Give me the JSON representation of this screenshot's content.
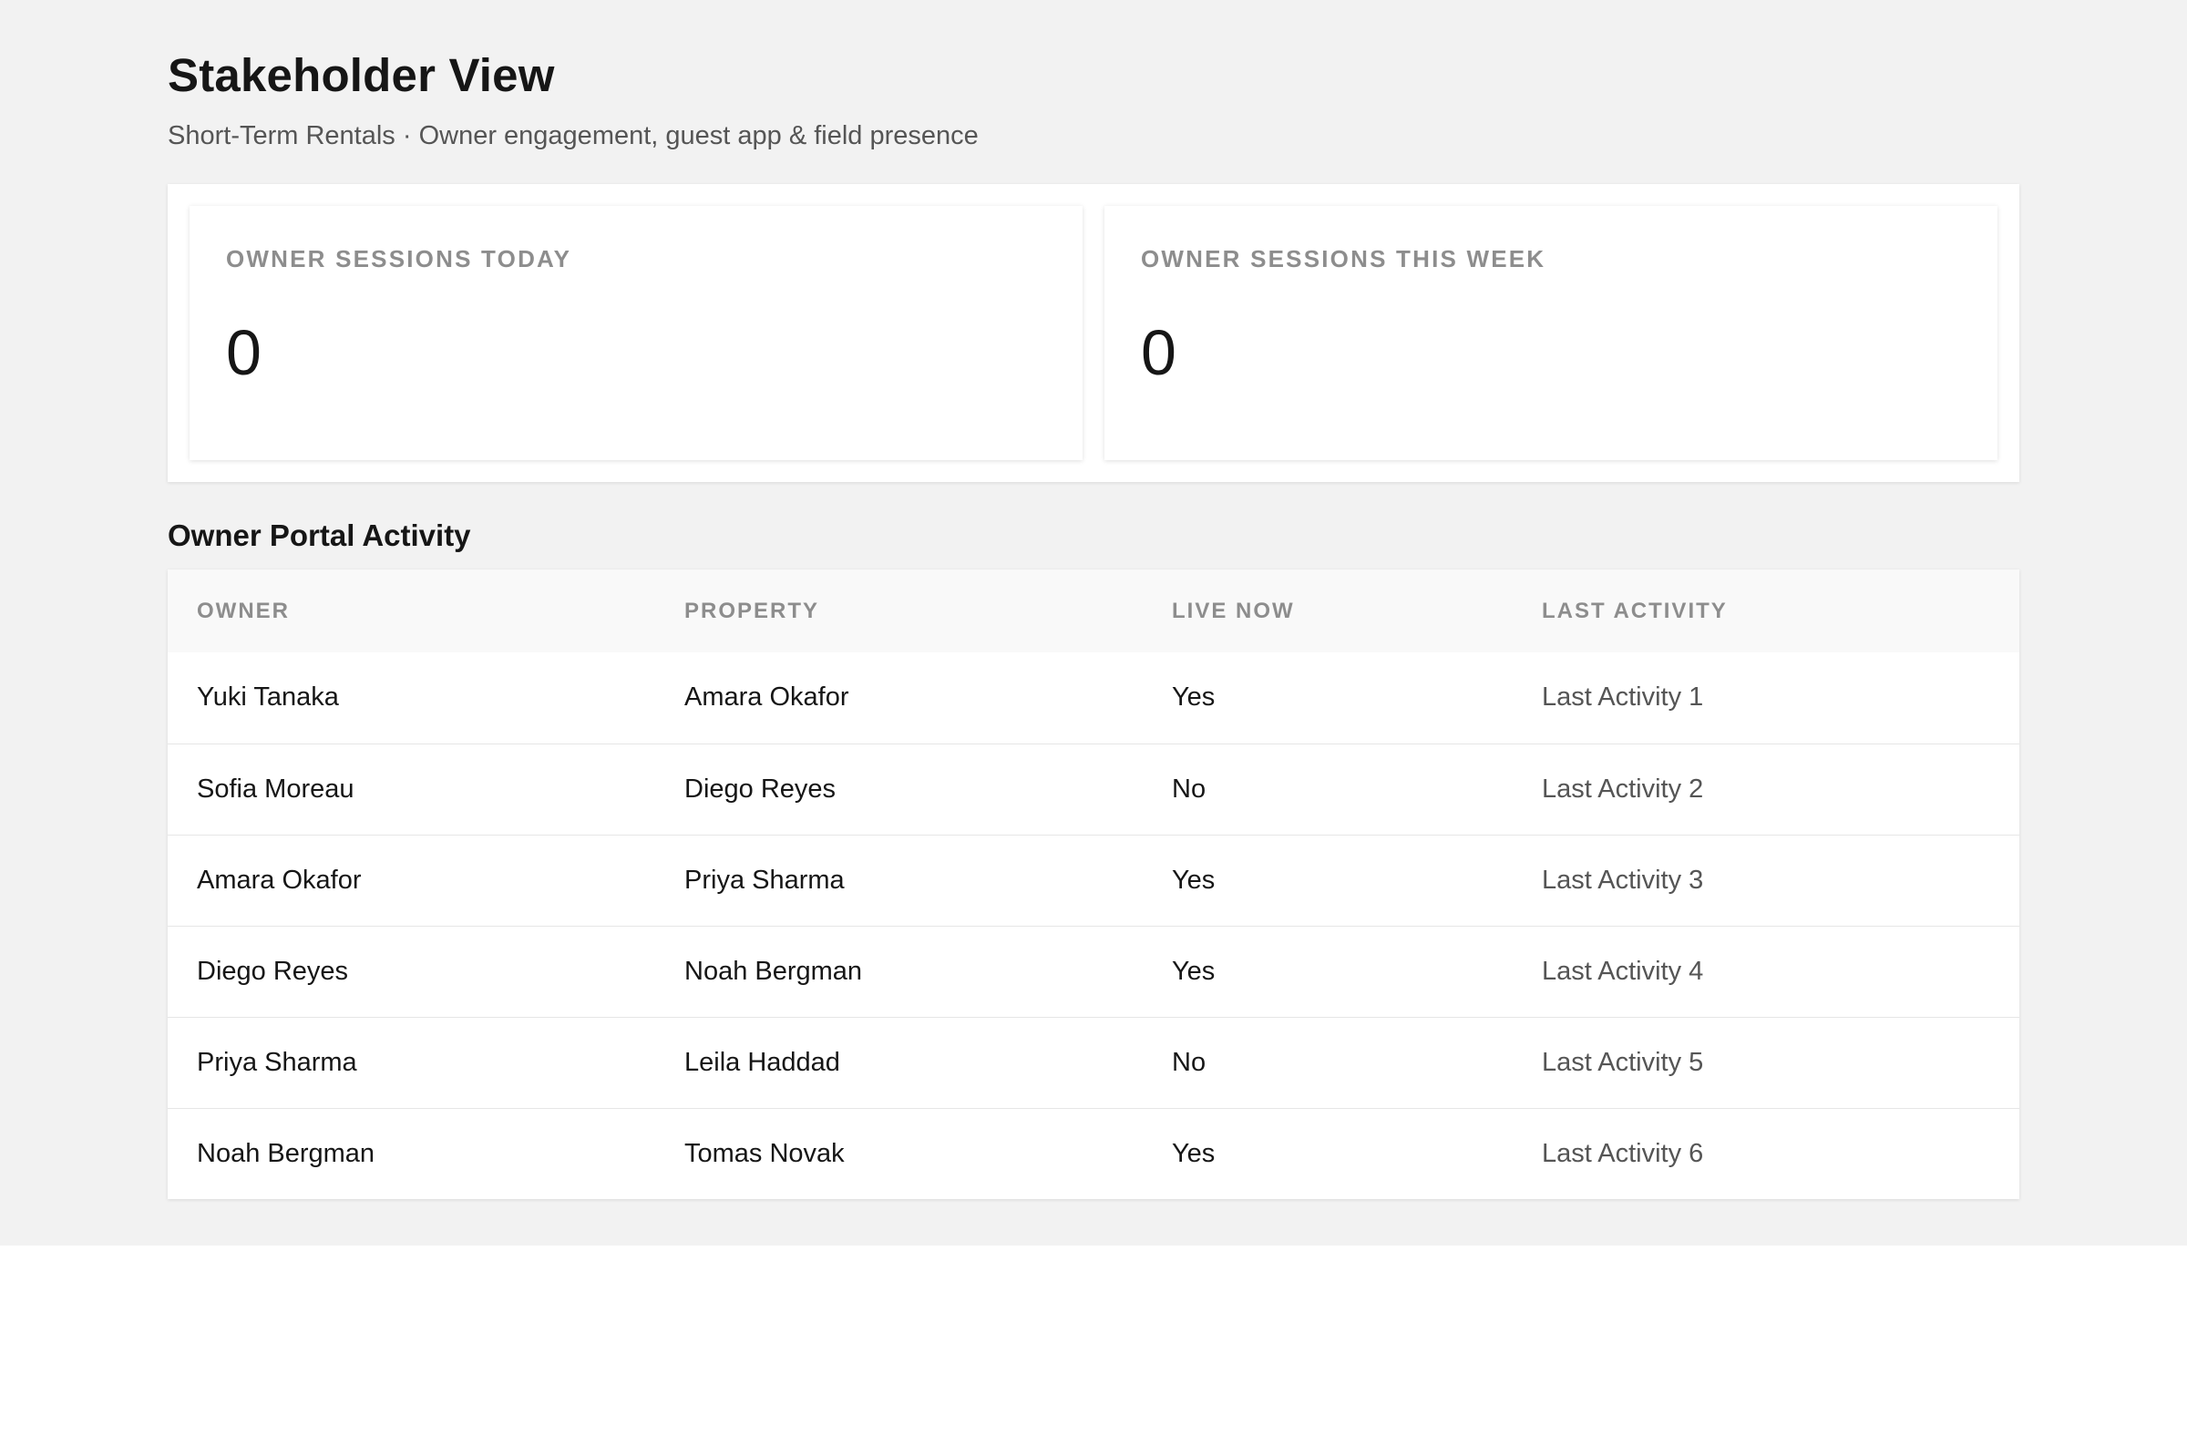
{
  "header": {
    "title": "Stakeholder View",
    "subtitle": "Short-Term Rentals · Owner engagement, guest app & field presence"
  },
  "kpis": [
    {
      "label": "OWNER SESSIONS TODAY",
      "value": "0"
    },
    {
      "label": "OWNER SESSIONS THIS WEEK",
      "value": "0"
    }
  ],
  "owner_activity": {
    "title": "Owner Portal Activity",
    "columns": [
      "OWNER",
      "PROPERTY",
      "LIVE NOW",
      "LAST ACTIVITY"
    ],
    "rows": [
      {
        "owner": "Yuki Tanaka",
        "property": "Amara Okafor",
        "live_now": "Yes",
        "last_activity": "Last Activity 1"
      },
      {
        "owner": "Sofia Moreau",
        "property": "Diego Reyes",
        "live_now": "No",
        "last_activity": "Last Activity 2"
      },
      {
        "owner": "Amara Okafor",
        "property": "Priya Sharma",
        "live_now": "Yes",
        "last_activity": "Last Activity 3"
      },
      {
        "owner": "Diego Reyes",
        "property": "Noah Bergman",
        "live_now": "Yes",
        "last_activity": "Last Activity 4"
      },
      {
        "owner": "Priya Sharma",
        "property": "Leila Haddad",
        "live_now": "No",
        "last_activity": "Last Activity 5"
      },
      {
        "owner": "Noah Bergman",
        "property": "Tomas Novak",
        "live_now": "Yes",
        "last_activity": "Last Activity 6"
      }
    ]
  }
}
